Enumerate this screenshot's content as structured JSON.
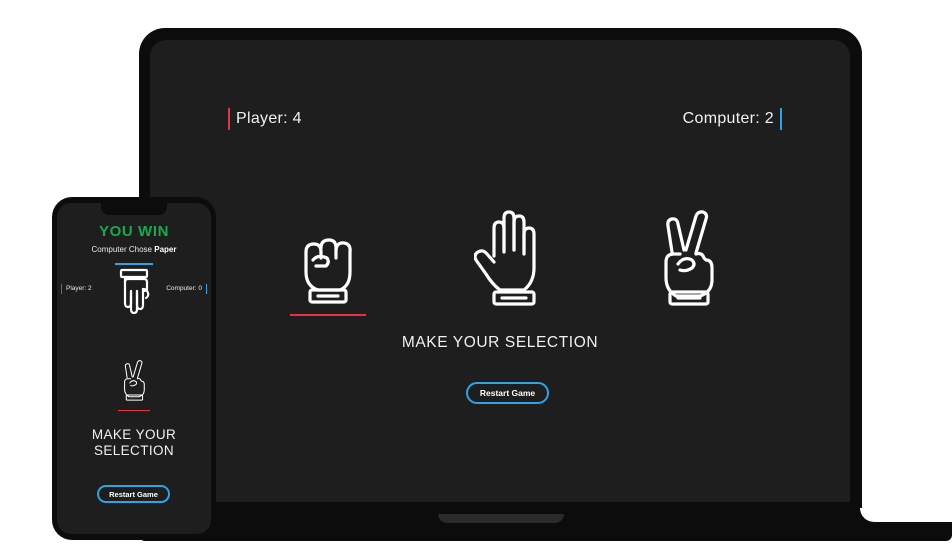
{
  "laptop": {
    "player_score": "Player: 4",
    "computer_score": "Computer: 2",
    "choices": [
      {
        "label": "Rock",
        "icon": "fist-icon"
      },
      {
        "label": "Paper",
        "icon": "open-hand-icon"
      },
      {
        "label": "Scissors",
        "icon": "peace-hand-icon"
      }
    ],
    "prompt": "MAKE YOUR SELECTION",
    "restart_label": "Restart Game"
  },
  "phone": {
    "result": "YOU WIN",
    "computer_chose_prefix": "Computer Chose",
    "computer_choice": "Paper",
    "player_score": "Player: 2",
    "computer_score": "Computer: 0",
    "prompt": "MAKE YOUR SELECTION",
    "restart_label": "Restart Game"
  },
  "colors": {
    "background": "#1e1e1f",
    "player_accent": "#e53344",
    "computer_accent": "#2ea4e6",
    "win": "#1aa84b",
    "text": "#f1f1f1"
  }
}
